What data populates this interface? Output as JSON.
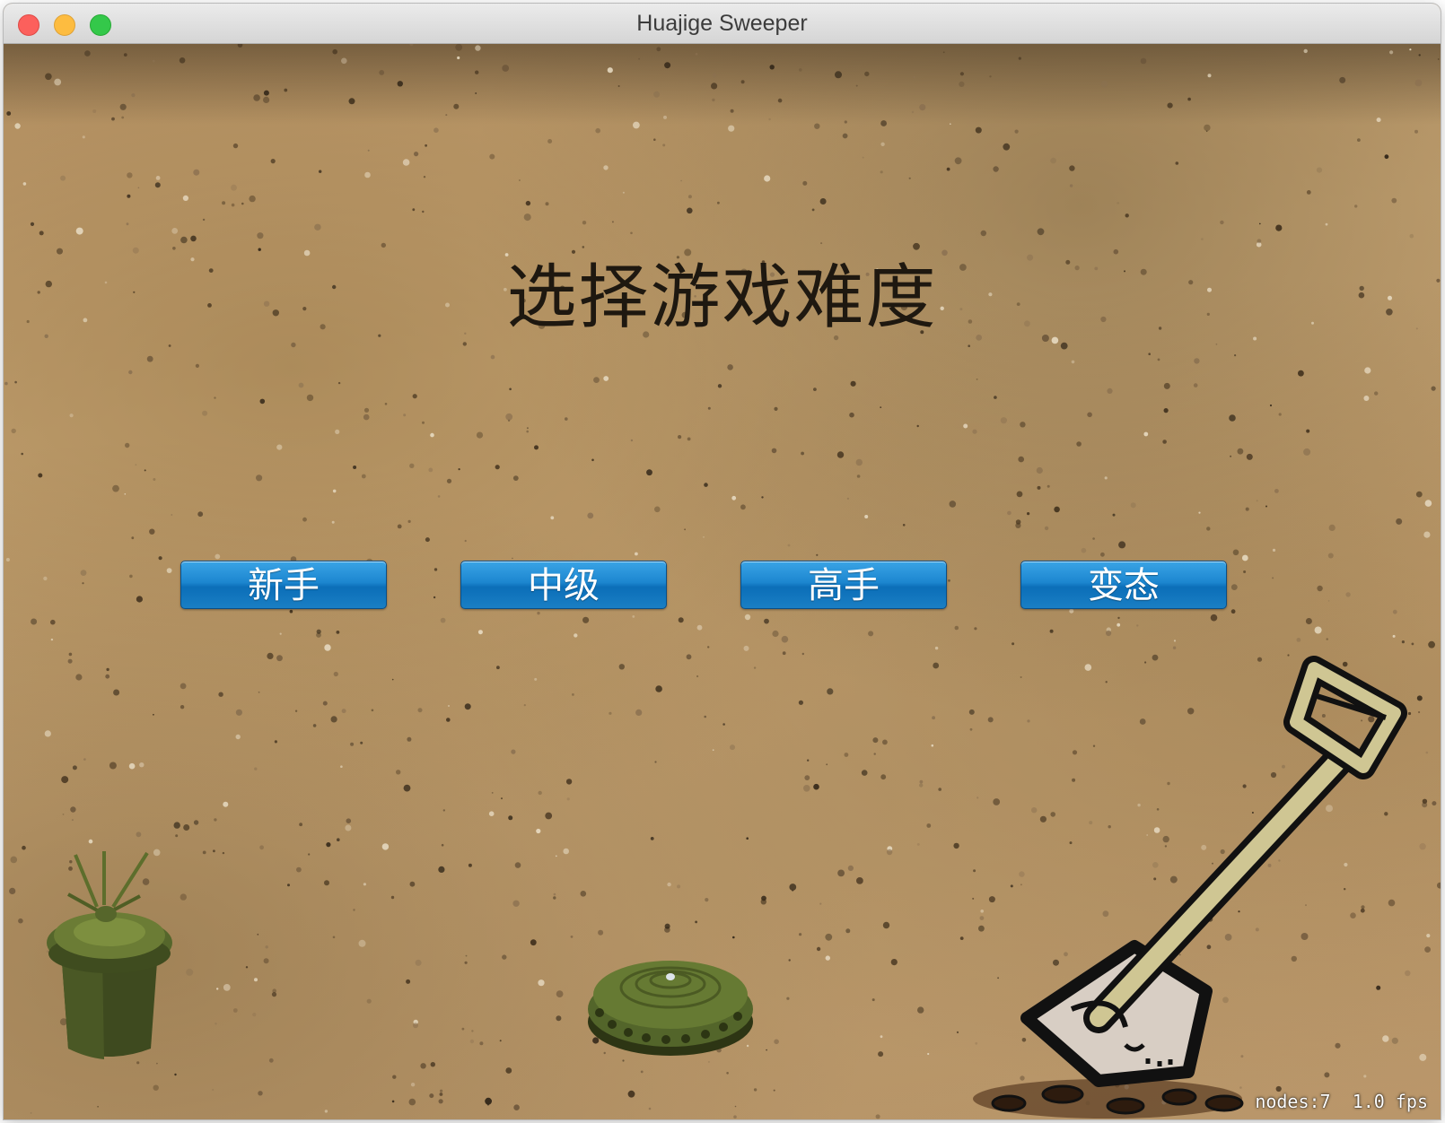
{
  "window": {
    "title": "Huajige Sweeper"
  },
  "scene": {
    "heading": "选择游戏难度",
    "difficulty_buttons": [
      {
        "label": "新手"
      },
      {
        "label": "中级"
      },
      {
        "label": "高手"
      },
      {
        "label": "变态"
      }
    ],
    "stats": {
      "nodes": "nodes:7",
      "fps": "1.0 fps"
    },
    "sprites": [
      "landmine-canister-icon",
      "pressure-mine-icon",
      "shovel-icon"
    ]
  },
  "colors": {
    "button_blue": "#1c86cf",
    "dirt": "#c4a070",
    "mine_green": "#4e5f2a"
  }
}
